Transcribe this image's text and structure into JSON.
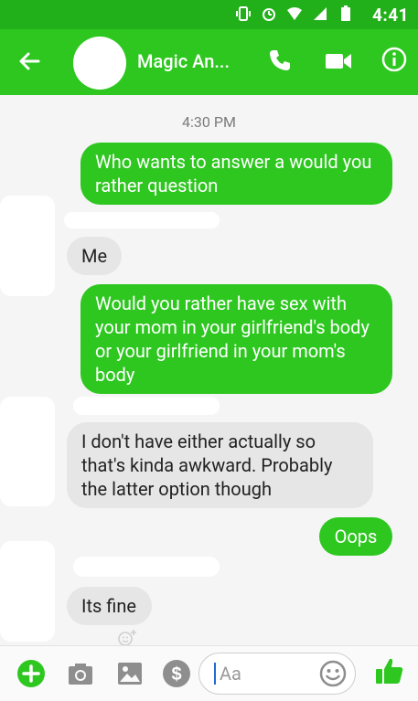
{
  "status_bar": {
    "time": "4:41"
  },
  "header": {
    "title": "Magic An..."
  },
  "chat": {
    "timestamp": "4:30 PM",
    "messages": [
      {
        "side": "out",
        "text": "Who wants to answer a would you rather question"
      },
      {
        "side": "in",
        "text": "Me"
      },
      {
        "side": "out",
        "text": "Would you rather have sex with your mom in your girlfriend's body or your girlfriend in your mom's body"
      },
      {
        "side": "in",
        "text": "I don't have either actually so that's kinda awkward. Probably the latter option though"
      },
      {
        "side": "out",
        "text": "Oops"
      },
      {
        "side": "in",
        "text": "Its fine"
      }
    ]
  },
  "composer": {
    "placeholder": "Aa"
  },
  "colors": {
    "accent": "#2ec720",
    "status_bar": "#22b01a",
    "incoming_bubble": "#e6e6e6"
  },
  "icons": [
    "back-arrow-icon",
    "phone-icon",
    "video-camera-icon",
    "info-icon",
    "plus-icon",
    "camera-icon",
    "gallery-icon",
    "dollar-icon",
    "emoji-icon",
    "thumbs-up-icon",
    "add-reaction-icon"
  ]
}
